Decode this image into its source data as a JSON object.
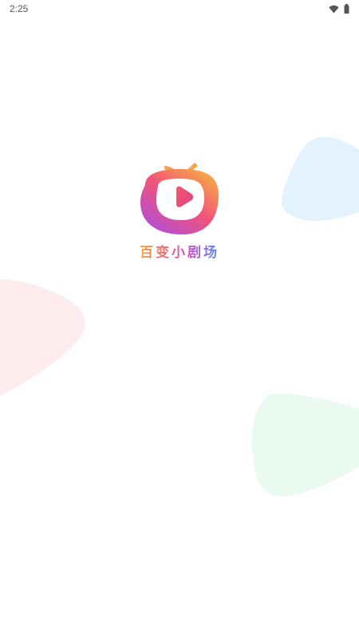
{
  "status_bar": {
    "time": "2:25",
    "wifi_icon": "wifi-icon",
    "battery_icon": "battery-icon"
  },
  "splash": {
    "logo_icon": "tv-play-logo-icon",
    "app_name": "百变小剧场"
  },
  "colors": {
    "background": "#ffffff",
    "blob_blue": "#e3f3fd",
    "blob_pink": "#fdebee",
    "blob_green": "#eafaf1",
    "logo_gradient_start": "#f7a14a",
    "logo_gradient_mid": "#f25479",
    "logo_gradient_end": "#b04fd6"
  }
}
